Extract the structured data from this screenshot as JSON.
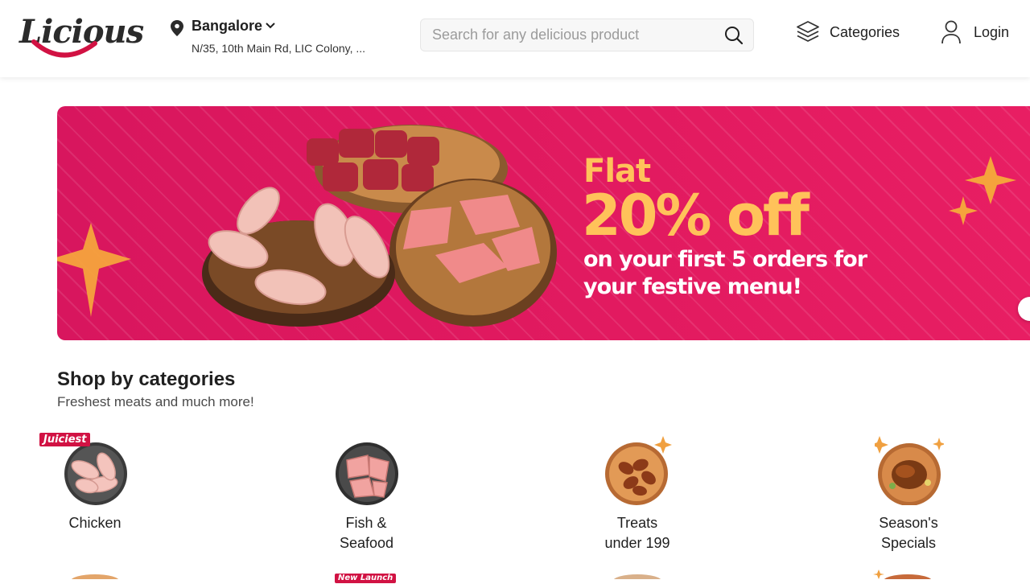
{
  "header": {
    "logo": "Licious",
    "location": {
      "city": "Bangalore",
      "address": "N/35, 10th Main Rd, LIC Colony, ..."
    },
    "search": {
      "placeholder": "Search for any delicious product"
    },
    "nav": {
      "categories": "Categories",
      "login": "Login"
    }
  },
  "banner": {
    "line1": "Flat",
    "line2": "20% off",
    "line3": "on your first 5 orders for your festive menu!"
  },
  "categories": {
    "title": "Shop by categories",
    "subtitle": "Freshest meats and much more!",
    "items": [
      {
        "name": "Chicken",
        "tag": "Juiciest"
      },
      {
        "name": "Fish & Seafood"
      },
      {
        "name": "Treats under 199"
      },
      {
        "name": "Season's Specials"
      }
    ],
    "next_row_tag": "New Launch"
  },
  "colors": {
    "brand": "#d11243",
    "banner": "#e0195f",
    "accent_gold": "#ffc25a"
  }
}
